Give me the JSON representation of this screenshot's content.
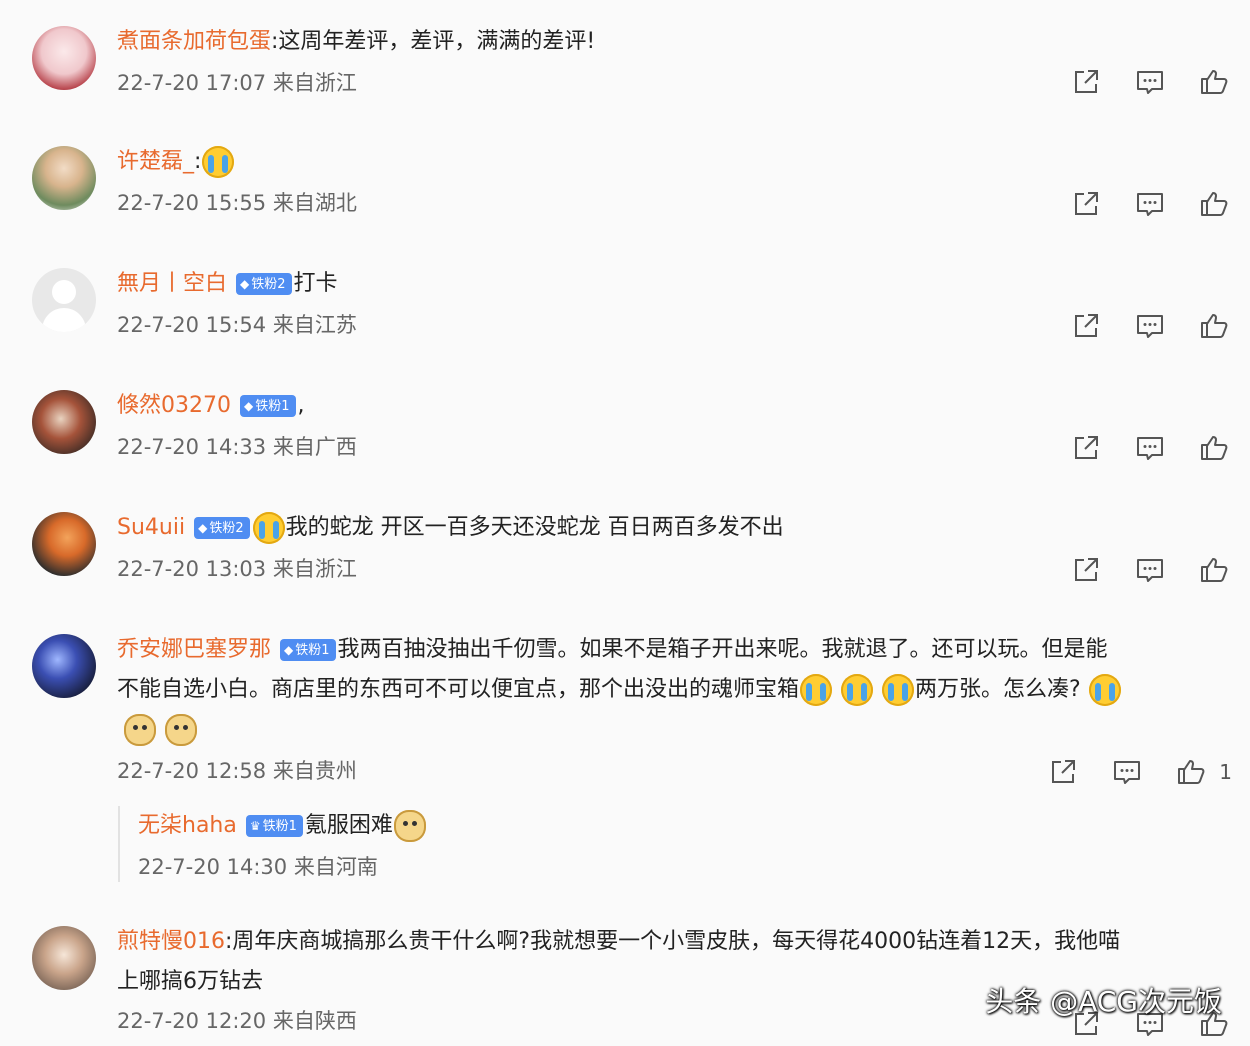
{
  "comments": [
    {
      "user": "煮面条加荷包蛋",
      "badge": "",
      "text": ":这周年差评，差评，满满的差评!",
      "time": "22-7-20 17:07",
      "location": "来自浙江",
      "likes": ""
    },
    {
      "user": "许楚磊_",
      "badge": "",
      "text": ":",
      "time": "22-7-20 15:55",
      "location": "来自湖北",
      "likes": ""
    },
    {
      "user": "無月丨空白",
      "badge": "铁粉2",
      "text": "打卡",
      "time": "22-7-20 15:54",
      "location": "来自江苏",
      "likes": ""
    },
    {
      "user": "倏然03270",
      "badge": "铁粉1",
      "text": ",",
      "time": "22-7-20 14:33",
      "location": "来自广西",
      "likes": ""
    },
    {
      "user": "Su4uii",
      "badge": "铁粉2",
      "text": "我的蛇龙 开区一百多天还没蛇龙 百日两百多发不出",
      "time": "22-7-20 13:03",
      "location": "来自浙江",
      "likes": ""
    },
    {
      "user": "乔安娜巴塞罗那",
      "badge": "铁粉1",
      "text": "我两百抽没抽出千仞雪。如果不是箱子开出来呢。我就退了。还可以玩。但是能",
      "text2": "不能自选小白。商店里的东西可不可以便宜点，那个出没出的魂师宝箱",
      "text3": "两万张。怎么凑?",
      "time": "22-7-20 12:58",
      "location": "来自贵州",
      "likes": "1",
      "reply": {
        "user": "无柒haha",
        "badge": "铁粉1",
        "text": "氪服困难",
        "time": "22-7-20 14:30",
        "location": "来自河南"
      }
    },
    {
      "user": "煎特慢016",
      "badge": "",
      "text": ":周年庆商城搞那么贵干什么啊?我就想要一个小雪皮肤，每天得花4000钻连着12天，我他喵",
      "text2": "上哪搞6万钻去",
      "time": "22-7-20 12:20",
      "location": "来自陕西",
      "likes": ""
    }
  ],
  "watermark": "头条 @ACG次元饭",
  "icons": {
    "share": "share-icon",
    "comment": "comment-icon",
    "like": "thumbs-up-icon",
    "badge": "diamond-icon"
  },
  "colors": {
    "username": "#e86a2e",
    "badge": "#4f8df2",
    "background": "#fafafa"
  }
}
